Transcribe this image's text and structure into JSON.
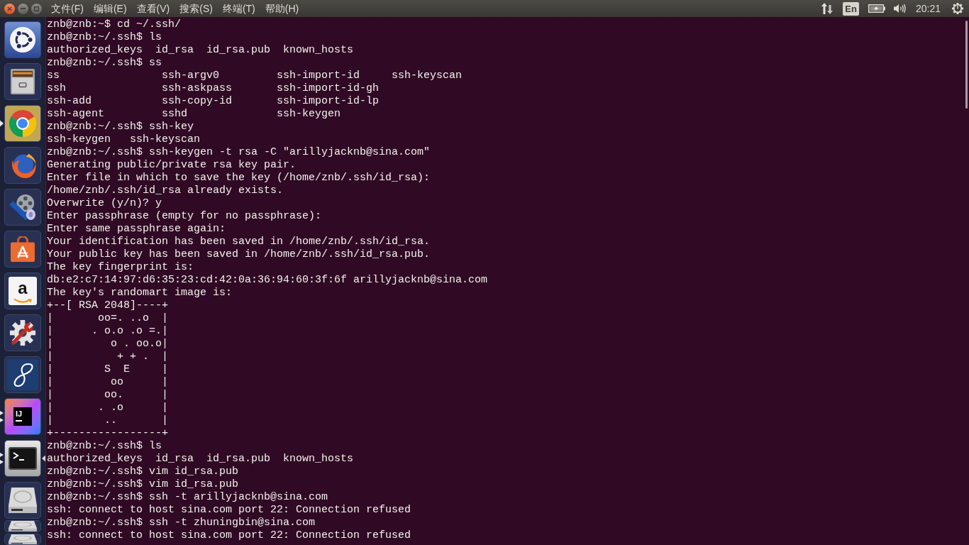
{
  "menu_bar": {
    "menus": [
      "文件(F)",
      "编辑(E)",
      "查看(V)",
      "搜索(S)",
      "终端(T)",
      "帮助(H)"
    ],
    "keyboard_layout": "En",
    "clock": "20:21"
  },
  "launcher": {
    "items": [
      {
        "kind": "dash",
        "running": false,
        "multiple_windows": false,
        "focused": false
      },
      {
        "kind": "files",
        "running": false,
        "multiple_windows": false,
        "focused": false
      },
      {
        "kind": "browser",
        "running": true,
        "multiple_windows": false,
        "focused": false
      },
      {
        "kind": "fox",
        "running": false,
        "multiple_windows": false,
        "focused": false
      },
      {
        "kind": "reel",
        "running": false,
        "multiple_windows": false,
        "focused": false
      },
      {
        "kind": "bag",
        "running": false,
        "multiple_windows": false,
        "focused": false
      },
      {
        "kind": "smile",
        "label": "a",
        "running": false,
        "multiple_windows": false,
        "focused": false
      },
      {
        "kind": "tools",
        "running": false,
        "multiple_windows": false,
        "focused": false
      },
      {
        "kind": "eight",
        "running": false,
        "multiple_windows": false,
        "focused": false
      },
      {
        "kind": "ide",
        "label": "IJ",
        "running": true,
        "multiple_windows": true,
        "focused": false
      },
      {
        "kind": "terminal",
        "running": true,
        "multiple_windows": true,
        "focused": true
      },
      {
        "kind": "disk",
        "running": false,
        "multiple_windows": false,
        "focused": false
      },
      {
        "kind": "disk",
        "running": false,
        "multiple_windows": false,
        "focused": false
      },
      {
        "kind": "disk",
        "running": false,
        "multiple_windows": false,
        "focused": false
      }
    ]
  },
  "terminal": {
    "lines": [
      "znb@znb:~$ cd ~/.ssh/",
      "znb@znb:~/.ssh$ ls",
      "authorized_keys  id_rsa  id_rsa.pub  known_hosts",
      "znb@znb:~/.ssh$ ss",
      "ss                ssh-argv0         ssh-import-id     ssh-keyscan",
      "ssh               ssh-askpass       ssh-import-id-gh",
      "ssh-add           ssh-copy-id       ssh-import-id-lp",
      "ssh-agent         sshd              ssh-keygen",
      "znb@znb:~/.ssh$ ssh-key",
      "ssh-keygen   ssh-keyscan",
      "znb@znb:~/.ssh$ ssh-keygen -t rsa -C \"arillyjacknb@sina.com\"",
      "Generating public/private rsa key pair.",
      "Enter file in which to save the key (/home/znb/.ssh/id_rsa):",
      "/home/znb/.ssh/id_rsa already exists.",
      "Overwrite (y/n)? y",
      "Enter passphrase (empty for no passphrase):",
      "Enter same passphrase again:",
      "Your identification has been saved in /home/znb/.ssh/id_rsa.",
      "Your public key has been saved in /home/znb/.ssh/id_rsa.pub.",
      "The key fingerprint is:",
      "db:e2:c7:14:97:d6:35:23:cd:42:0a:36:94:60:3f:6f arillyjacknb@sina.com",
      "The key's randomart image is:",
      "+--[ RSA 2048]----+",
      "|       oo=. ..o  |",
      "|      . o.o .o =.|",
      "|         o . oo.o|",
      "|          + + .  |",
      "|        S  E     |",
      "|         oo      |",
      "|        oo.      |",
      "|       . .o      |",
      "|        ..       |",
      "+-----------------+",
      "znb@znb:~/.ssh$ ls",
      "authorized_keys  id_rsa  id_rsa.pub  known_hosts",
      "znb@znb:~/.ssh$ vim id_rsa.pub",
      "znb@znb:~/.ssh$ vim id_rsa.pub",
      "znb@znb:~/.ssh$ ssh -t arillyjacknb@sina.com",
      "ssh: connect to host sina.com port 22: Connection refused",
      "znb@znb:~/.ssh$ ssh -t zhuningbin@sina.com",
      "ssh: connect to host sina.com port 22: Connection refused"
    ]
  }
}
